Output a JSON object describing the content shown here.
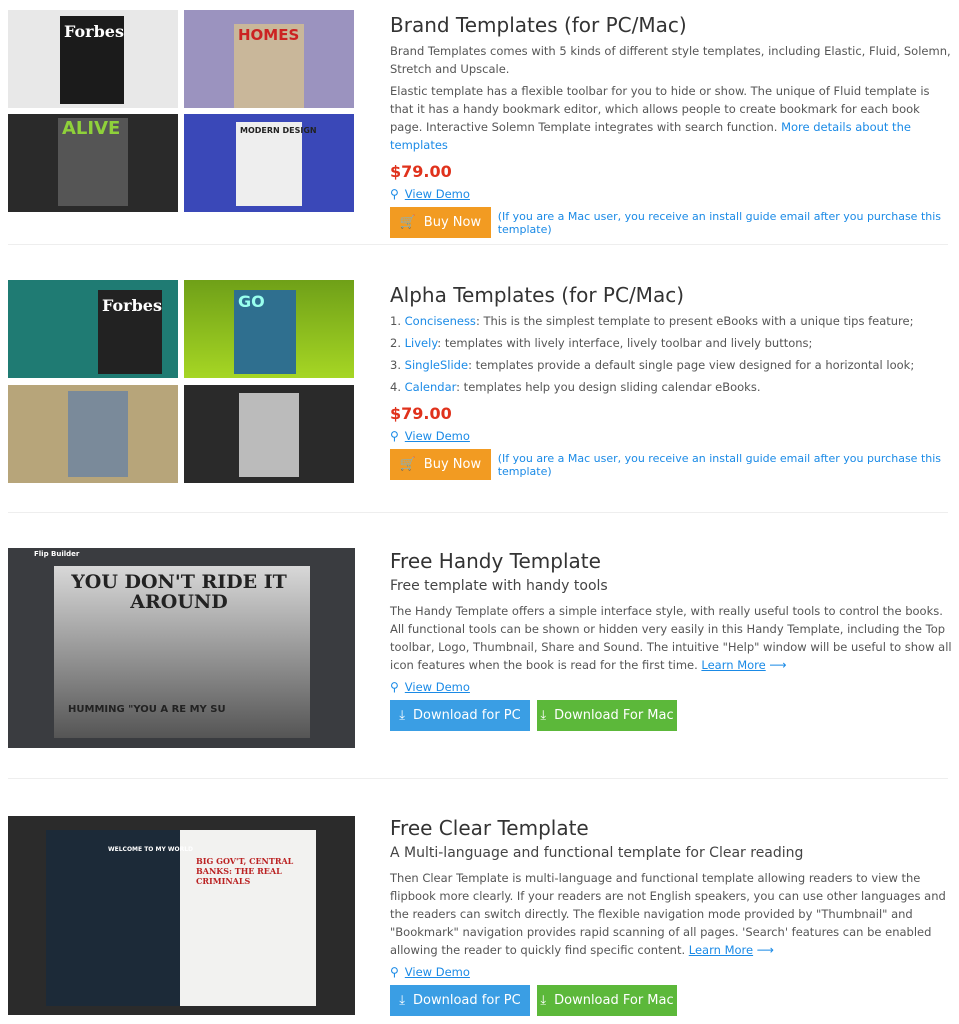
{
  "sections": [
    {
      "title": "Brand Templates (for PC/Mac)",
      "p1": "Brand Templates comes with 5 kinds of different style templates, including Elastic, Fluid, Solemn, Stretch and Upscale.",
      "p2": "Elastic template has a flexible toolbar for you to hide or show. The unique of Fluid template is that it has a handy bookmark editor, which allows people to create bookmark for each book page. Interactive Solemn Template integrates with search function. ",
      "link": "More details about the templates",
      "price": "$79.00",
      "demo": "View Demo",
      "buy": "Buy Now",
      "note": "(If you are a Mac user, you receive an install guide email after you purchase this template)",
      "thumbs": [
        "Forbes",
        "HOMES",
        "ALIVE",
        "MODERN DESIGN"
      ]
    },
    {
      "title": "Alpha Templates (for PC/Mac)",
      "items": [
        {
          "n": "1. ",
          "name": "Conciseness",
          "text": ": This is the simplest template to present eBooks with a unique tips feature;"
        },
        {
          "n": "2. ",
          "name": "Lively",
          "text": ": templates with lively interface, lively toolbar and lively buttons;"
        },
        {
          "n": "3. ",
          "name": "SingleSlide",
          "text": ": templates provide a default single page view designed for a horizontal look;"
        },
        {
          "n": "4. ",
          "name": "Calendar",
          "text": ": templates help you design sliding calendar eBooks."
        }
      ],
      "price": "$79.00",
      "demo": "View Demo",
      "buy": "Buy Now",
      "note": "(If you are a Mac user, you receive an install guide email after you purchase this template)",
      "thumbs": [
        "Forbes",
        "GO"
      ]
    },
    {
      "title": "Free Handy Template",
      "subtitle": "Free template with handy tools",
      "p1": "The Handy Template offers a simple interface style, with really useful tools to control the books. All functional tools can be shown or hidden very easily in this Handy Template, including the Top toolbar, Logo, Thumbnail, Share and Sound. The intuitive \"Help\" window will be useful to show all icon features when the book is read for the first time. ",
      "learn": "Learn More",
      "demo": "View Demo",
      "pc": "Download for PC",
      "mac": "Download For Mac",
      "shot": "YOU DON'T RIDE IT AROUND",
      "shot2": "HUMMING \"YOU A RE MY SU",
      "brand": "Flip Builder"
    },
    {
      "title": "Free Clear Template",
      "subtitle": "A Multi-language and functional template for Clear reading",
      "p1": "Then Clear Template is multi-language and functional template allowing readers to view the flipbook more clearly. If your readers are not English speakers, you can use other languages and the readers can switch directly. The flexible navigation mode provided by \"Thumbnail\" and \"Bookmark\" navigation provides rapid scanning of all pages. 'Search' features can be enabled allowing the reader to quickly find specific content. ",
      "learn": "Learn More",
      "demo": "View Demo",
      "pc": "Download for PC",
      "mac": "Download For Mac",
      "shot": "BIG GOV'T, CENTRAL BANKS: THE REAL CRIMINALS",
      "shot2": "WELCOME TO MY WORLD"
    }
  ]
}
